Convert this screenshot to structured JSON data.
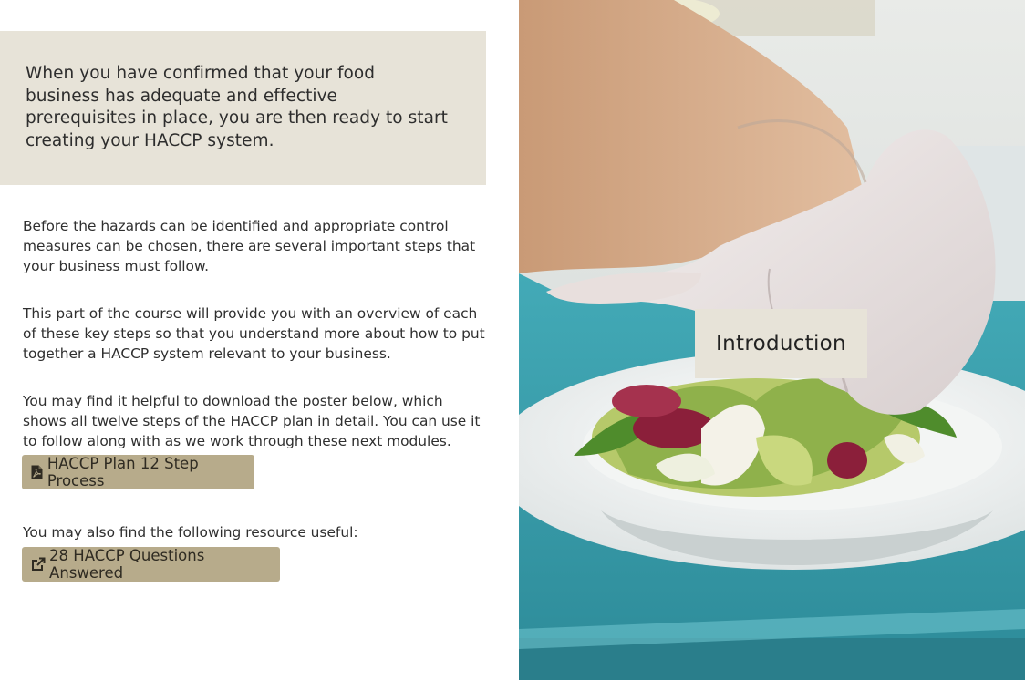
{
  "callout": {
    "text": "When you have confirmed that your food business has adequate and effective prerequisites in place, you are then ready to start creating your HACCP system."
  },
  "paragraphs": {
    "p1": "Before the hazards can be identified and appropriate control measures can be chosen, there are several important steps that your business must follow.",
    "p2": "This part of the course will provide you with an overview of each of these key steps so that you understand more about how to put together a HACCP system relevant to your business.",
    "p3": "You may find it helpful to download the poster below, which shows all twelve steps of the HACCP plan in detail. You can use it to follow along with as we work through these next modules.",
    "p4": "You may also find the following resource useful:"
  },
  "buttons": {
    "poster": {
      "label": "HACCP Plan 12 Step Process",
      "icon": "pdf-file-icon"
    },
    "questions": {
      "label": "28 HACCP Questions Answered",
      "icon": "external-link-icon"
    }
  },
  "photo": {
    "badge": "Introduction"
  },
  "colors": {
    "callout_bg": "#e7e3d8",
    "button_bg": "#b7ab8b",
    "tray_teal": "#3aa3b3"
  }
}
